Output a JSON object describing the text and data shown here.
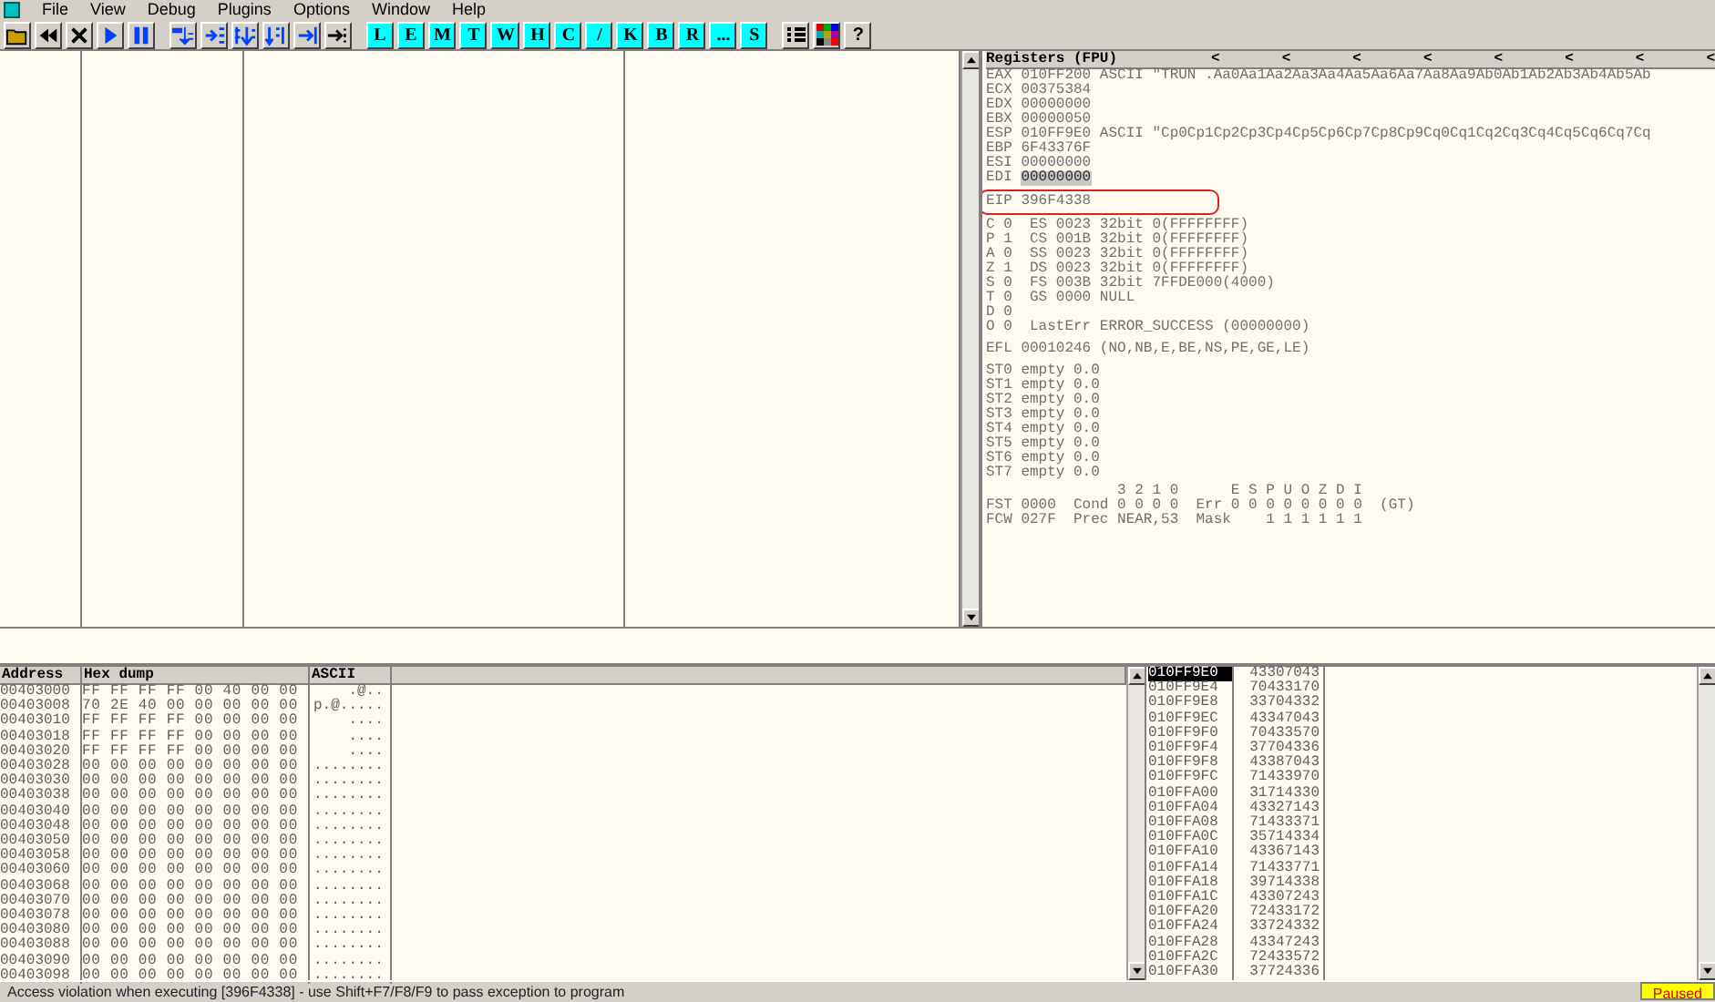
{
  "menu": [
    "File",
    "View",
    "Debug",
    "Plugins",
    "Options",
    "Window",
    "Help"
  ],
  "toolbar": {
    "icon_buttons_1": [
      {
        "kind": "open"
      },
      {
        "kind": "rewind"
      },
      {
        "kind": "close"
      },
      {
        "kind": "run"
      },
      {
        "kind": "pause"
      }
    ],
    "icon_buttons_2": [
      {
        "kind": "stepin"
      },
      {
        "kind": "stepover"
      },
      {
        "kind": "tracein"
      },
      {
        "kind": "traceover"
      },
      {
        "kind": "tillreturn"
      },
      {
        "kind": "goto"
      }
    ],
    "letters": [
      "L",
      "E",
      "M",
      "T",
      "W",
      "H",
      "C",
      "/",
      "K",
      "B",
      "R",
      "...",
      "S"
    ],
    "help": "?"
  },
  "registers": {
    "title": "Registers (FPU)",
    "arrows": [
      "<",
      "<",
      "<",
      "<",
      "<",
      "<",
      "<",
      "<"
    ],
    "general": [
      {
        "name": "EAX",
        "value": "010FF200",
        "comment": "ASCII \"TRUN .Aa0Aa1Aa2Aa3Aa4Aa5Aa6Aa7Aa8Aa9Ab0Ab1Ab2Ab3Ab4Ab5Ab",
        "changed": false
      },
      {
        "name": "ECX",
        "value": "00375384",
        "changed": false
      },
      {
        "name": "EDX",
        "value": "00000000",
        "changed": false
      },
      {
        "name": "EBX",
        "value": "00000050",
        "changed": false
      },
      {
        "name": "ESP",
        "value": "010FF9E0",
        "comment": "ASCII \"Cp0Cp1Cp2Cp3Cp4Cp5Cp6Cp7Cp8Cp9Cq0Cq1Cq2Cq3Cq4Cq5Cq6Cq7Cq",
        "changed": false
      },
      {
        "name": "EBP",
        "value": "6F43376F",
        "changed": false
      },
      {
        "name": "ESI",
        "value": "00000000",
        "changed": false
      },
      {
        "name": "EDI",
        "value": "00000000",
        "changed": true
      }
    ],
    "eip": {
      "name": "EIP",
      "value": "396F4338",
      "circled": true
    },
    "flags": [
      "C 0  ES 0023 32bit 0(FFFFFFFF)",
      "P 1  CS 001B 32bit 0(FFFFFFFF)",
      "A 0  SS 0023 32bit 0(FFFFFFFF)",
      "Z 1  DS 0023 32bit 0(FFFFFFFF)",
      "S 0  FS 003B 32bit 7FFDE000(4000)",
      "T 0  GS 0000 NULL",
      "D 0",
      "O 0  LastErr ERROR_SUCCESS (00000000)"
    ],
    "efl": "EFL 00010246 (NO,NB,E,BE,NS,PE,GE,LE)",
    "fpu": [
      "ST0 empty 0.0",
      "ST1 empty 0.0",
      "ST2 empty 0.0",
      "ST3 empty 0.0",
      "ST4 empty 0.0",
      "ST5 empty 0.0",
      "ST6 empty 0.0",
      "ST7 empty 0.0"
    ],
    "fpu_status": [
      "               3 2 1 0      E S P U O Z D I",
      "FST 0000  Cond 0 0 0 0  Err 0 0 0 0 0 0 0 0  (GT)",
      "FCW 027F  Prec NEAR,53  Mask    1 1 1 1 1 1"
    ]
  },
  "dump": {
    "columns": [
      "Address",
      "Hex dump",
      "ASCII"
    ],
    "rows": [
      {
        "address": "00403000",
        "hex": "FF FF FF FF 00 40 00 00",
        "ascii": "    .@.."
      },
      {
        "address": "00403008",
        "hex": "70 2E 40 00 00 00 00 00",
        "ascii": "p.@....."
      },
      {
        "address": "00403010",
        "hex": "FF FF FF FF 00 00 00 00",
        "ascii": "    ...."
      },
      {
        "address": "00403018",
        "hex": "FF FF FF FF 00 00 00 00",
        "ascii": "    ...."
      },
      {
        "address": "00403020",
        "hex": "FF FF FF FF 00 00 00 00",
        "ascii": "    ...."
      },
      {
        "address": "00403028",
        "hex": "00 00 00 00 00 00 00 00",
        "ascii": "........"
      },
      {
        "address": "00403030",
        "hex": "00 00 00 00 00 00 00 00",
        "ascii": "........"
      },
      {
        "address": "00403038",
        "hex": "00 00 00 00 00 00 00 00",
        "ascii": "........"
      },
      {
        "address": "00403040",
        "hex": "00 00 00 00 00 00 00 00",
        "ascii": "........"
      },
      {
        "address": "00403048",
        "hex": "00 00 00 00 00 00 00 00",
        "ascii": "........"
      },
      {
        "address": "00403050",
        "hex": "00 00 00 00 00 00 00 00",
        "ascii": "........"
      },
      {
        "address": "00403058",
        "hex": "00 00 00 00 00 00 00 00",
        "ascii": "........"
      },
      {
        "address": "00403060",
        "hex": "00 00 00 00 00 00 00 00",
        "ascii": "........"
      },
      {
        "address": "00403068",
        "hex": "00 00 00 00 00 00 00 00",
        "ascii": "........"
      },
      {
        "address": "00403070",
        "hex": "00 00 00 00 00 00 00 00",
        "ascii": "........"
      },
      {
        "address": "00403078",
        "hex": "00 00 00 00 00 00 00 00",
        "ascii": "........"
      },
      {
        "address": "00403080",
        "hex": "00 00 00 00 00 00 00 00",
        "ascii": "........"
      },
      {
        "address": "00403088",
        "hex": "00 00 00 00 00 00 00 00",
        "ascii": "........"
      },
      {
        "address": "00403090",
        "hex": "00 00 00 00 00 00 00 00",
        "ascii": "........"
      },
      {
        "address": "00403098",
        "hex": "00 00 00 00 00 00 00 00",
        "ascii": "........"
      }
    ]
  },
  "stack": [
    {
      "address": "010FF9E0",
      "value": "43307043",
      "selected": true
    },
    {
      "address": "010FF9E4",
      "value": "70433170",
      "selected": false
    },
    {
      "address": "010FF9E8",
      "value": "33704332",
      "selected": false
    },
    {
      "address": "010FF9EC",
      "value": "43347043",
      "selected": false
    },
    {
      "address": "010FF9F0",
      "value": "70433570",
      "selected": false
    },
    {
      "address": "010FF9F4",
      "value": "37704336",
      "selected": false
    },
    {
      "address": "010FF9F8",
      "value": "43387043",
      "selected": false
    },
    {
      "address": "010FF9FC",
      "value": "71433970",
      "selected": false
    },
    {
      "address": "010FFA00",
      "value": "31714330",
      "selected": false
    },
    {
      "address": "010FFA04",
      "value": "43327143",
      "selected": false
    },
    {
      "address": "010FFA08",
      "value": "71433371",
      "selected": false
    },
    {
      "address": "010FFA0C",
      "value": "35714334",
      "selected": false
    },
    {
      "address": "010FFA10",
      "value": "43367143",
      "selected": false
    },
    {
      "address": "010FFA14",
      "value": "71433771",
      "selected": false
    },
    {
      "address": "010FFA18",
      "value": "39714338",
      "selected": false
    },
    {
      "address": "010FFA1C",
      "value": "43307243",
      "selected": false
    },
    {
      "address": "010FFA20",
      "value": "72433172",
      "selected": false
    },
    {
      "address": "010FFA24",
      "value": "33724332",
      "selected": false
    },
    {
      "address": "010FFA28",
      "value": "43347243",
      "selected": false
    },
    {
      "address": "010FFA2C",
      "value": "72433572",
      "selected": false
    },
    {
      "address": "010FFA30",
      "value": "37724336",
      "selected": false
    }
  ],
  "status_bar": {
    "message": "Access violation when executing [396F4338] - use Shift+F7/F8/F9 to pass exception to program",
    "state": "Paused"
  }
}
